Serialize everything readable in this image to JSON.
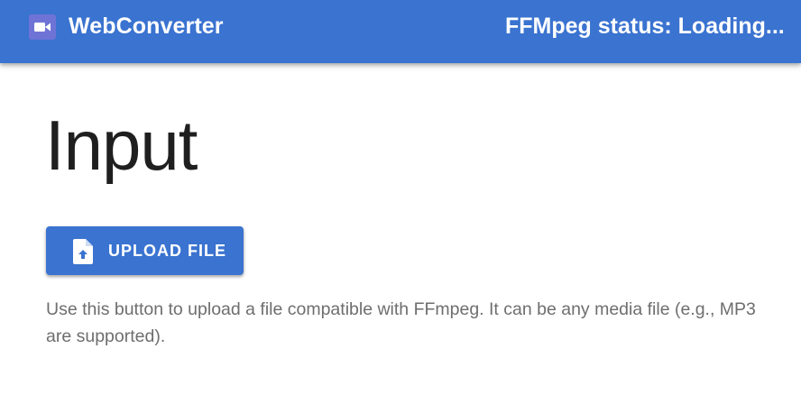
{
  "app_bar": {
    "logo_icon": "video-camera-icon",
    "title": "WebConverter",
    "status": "FFMpeg status: Loading..."
  },
  "main": {
    "title": "Input",
    "upload_button": {
      "icon": "file-upload-icon",
      "label": "UPLOAD FILE"
    },
    "description_lines": [
      "Use this button to upload a file compatible with FFmpeg. It can be any media file (e.g., MP3",
      "are supported)."
    ]
  },
  "colors": {
    "primary": "#3a73d0",
    "logo_bg": "#6f73d6",
    "title_text": "#1f1f1f",
    "body_text": "#6e6e6e"
  }
}
